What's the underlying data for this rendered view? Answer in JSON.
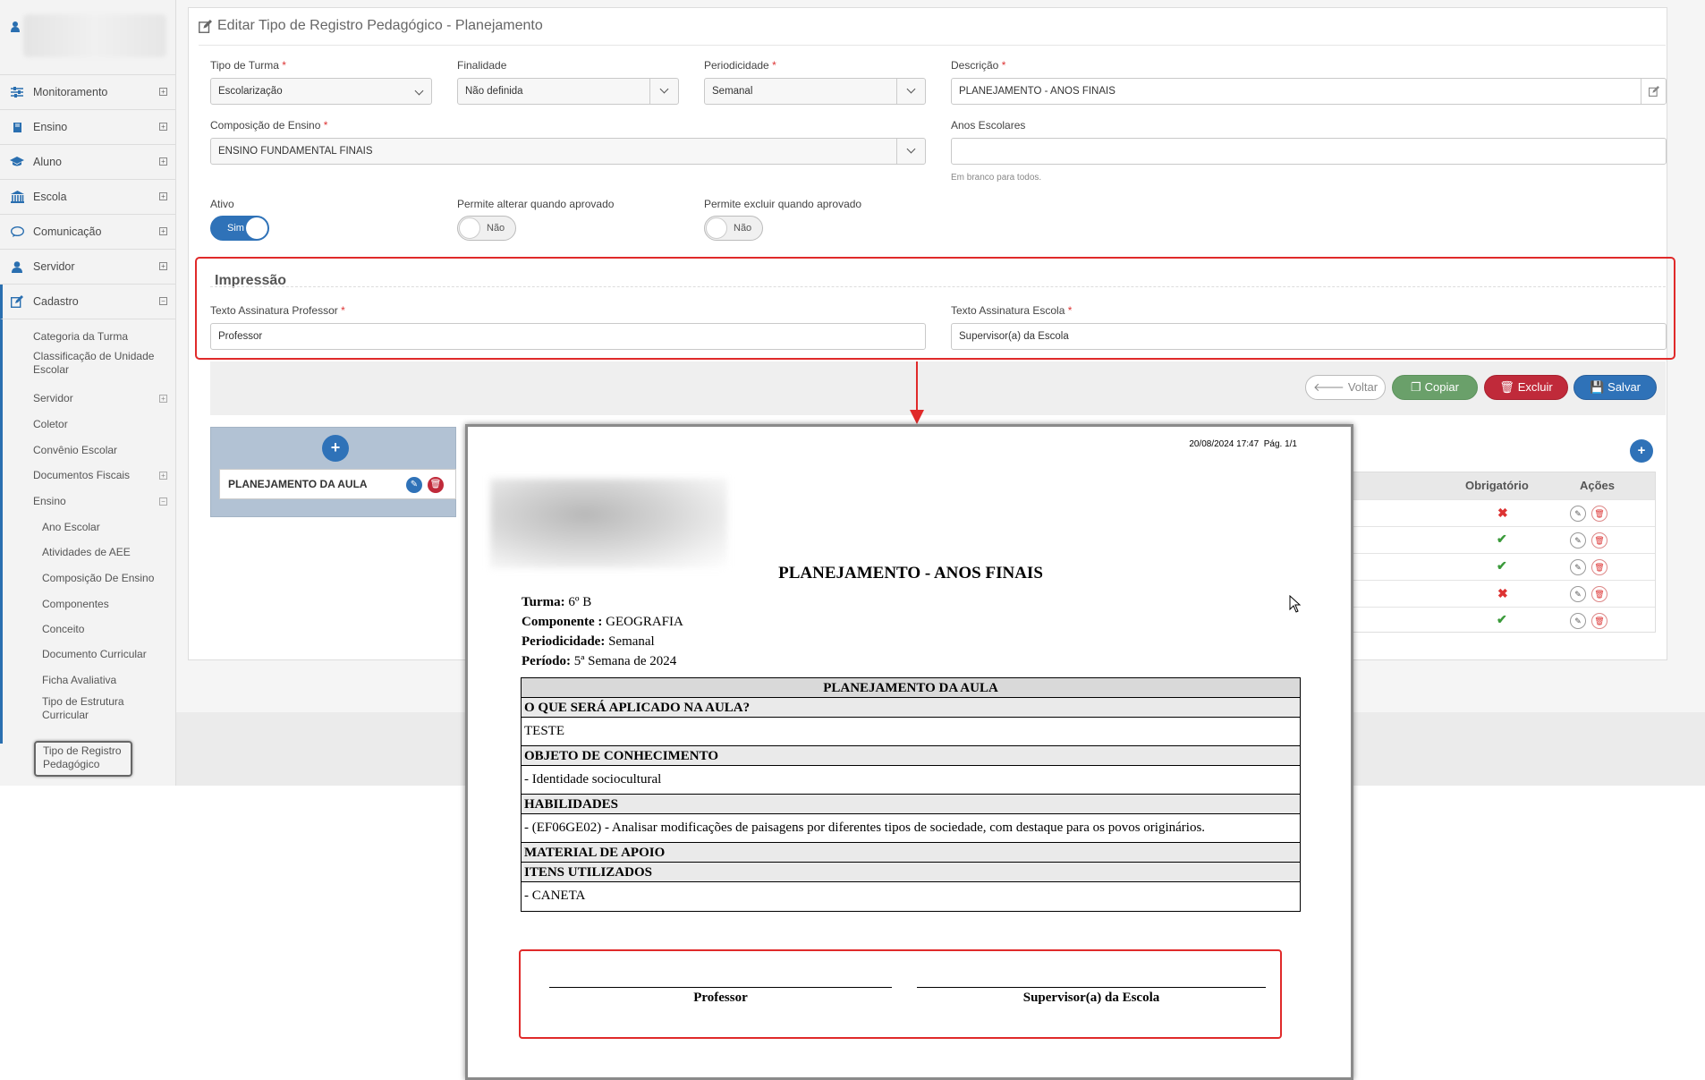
{
  "sidebar": {
    "menu": [
      {
        "label": "Monitoramento",
        "icon": "sliders-icon"
      },
      {
        "label": "Ensino",
        "icon": "book-icon"
      },
      {
        "label": "Aluno",
        "icon": "graduation-cap-icon"
      },
      {
        "label": "Escola",
        "icon": "bank-icon"
      },
      {
        "label": "Comunicação",
        "icon": "chat-bubble-icon"
      },
      {
        "label": "Servidor",
        "icon": "user-icon"
      },
      {
        "label": "Cadastro",
        "icon": "edit-icon"
      }
    ],
    "cadastro_items": [
      "Categoria da Turma",
      "Classificação de Unidade Escolar",
      "Servidor",
      "Coletor",
      "Convênio Escolar",
      "Documentos Fiscais",
      "Ensino"
    ],
    "ensino_items": [
      "Ano Escolar",
      "Atividades de AEE",
      "Composição De Ensino",
      "Componentes",
      "Conceito",
      "Documento Curricular",
      "Ficha Avaliativa",
      "Tipo de Estrutura Curricular",
      "Tipo de Registro Pedagógico"
    ]
  },
  "page": {
    "title": "Editar Tipo de Registro Pedagógico - Planejamento"
  },
  "form": {
    "tipo_turma": {
      "label": "Tipo de Turma",
      "value": "Escolarização"
    },
    "finalidade": {
      "label": "Finalidade",
      "value": "Não definida"
    },
    "periodicidade": {
      "label": "Periodicidade",
      "value": "Semanal"
    },
    "descricao": {
      "label": "Descrição",
      "value": "PLANEJAMENTO - ANOS FINAIS"
    },
    "composicao": {
      "label": "Composição de Ensino",
      "value": "ENSINO FUNDAMENTAL FINAIS"
    },
    "anos_escolares": {
      "label": "Anos Escolares",
      "value": "",
      "help": "Em branco para todos."
    },
    "ativo": {
      "label": "Ativo",
      "value": "Sim"
    },
    "permite_alterar": {
      "label": "Permite alterar quando aprovado",
      "value": "Não"
    },
    "permite_excluir": {
      "label": "Permite excluir quando aprovado",
      "value": "Não"
    },
    "required_mark": "*"
  },
  "impressao": {
    "legend": "Impressão",
    "prof_label": "Texto Assinatura Professor",
    "prof_value": "Professor",
    "escola_label": "Texto Assinatura Escola",
    "escola_value": "Supervisor(a) da Escola"
  },
  "actions": {
    "voltar": "Voltar",
    "copiar": "Copiar",
    "excluir": "Excluir",
    "salvar": "Salvar"
  },
  "items": {
    "add": "+",
    "card": "PLANEJAMENTO DA AULA"
  },
  "table": {
    "headers": [
      "Obrigatório",
      "Ações"
    ],
    "rows": [
      {
        "obrigatorio": false
      },
      {
        "obrigatorio": true
      },
      {
        "obrigatorio": true
      },
      {
        "obrigatorio": false
      },
      {
        "obrigatorio": true
      }
    ]
  },
  "report": {
    "date": "20/08/2024 17:47",
    "page": "Pág. 1/1",
    "title": "PLANEJAMENTO - ANOS FINAIS",
    "turma_label": "Turma:",
    "turma": "6º B",
    "componente_label": "Componente :",
    "componente": "GEOGRAFIA",
    "periodicidade_label": "Periodicidade:",
    "periodicidade": "Semanal",
    "periodo_label": "Período:",
    "periodo": "5ª Semana de 2024",
    "table_title": "PLANEJAMENTO DA AULA",
    "sections": [
      {
        "title": "O QUE SERÁ APLICADO NA AULA?",
        "body": "TESTE"
      },
      {
        "title": "OBJETO DE CONHECIMENTO",
        "body": "- Identidade sociocultural"
      },
      {
        "title": "HABILIDADES",
        "body": "- (EF06GE02) - Analisar modificações de paisagens por diferentes tipos de sociedade, com destaque para os povos originários."
      },
      {
        "title": "MATERIAL DE APOIO",
        "body": null
      },
      {
        "title": "ITENS UTILIZADOS",
        "body": "- CANETA"
      }
    ],
    "sig_professor": "Professor",
    "sig_escola": "Supervisor(a) da Escola"
  },
  "colors": {
    "primary": "#2f72b8",
    "danger": "#c02a3a",
    "success": "#6aa06a",
    "highlight": "#e02a2a"
  }
}
